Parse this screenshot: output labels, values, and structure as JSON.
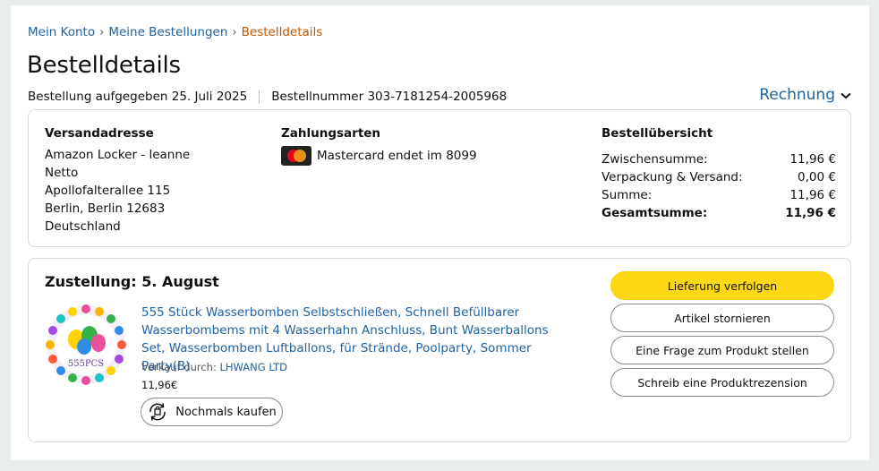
{
  "breadcrumb": {
    "items": [
      "Mein Konto",
      "Meine Bestellungen"
    ],
    "current": "Bestelldetails",
    "separator": "›"
  },
  "page_title": "Bestelldetails",
  "order_meta": {
    "placed": "Bestellung aufgegeben 25. Juli 2025",
    "number": "Bestellnummer 303-7181254-2005968"
  },
  "invoice_label": "Rechnung",
  "shipping": {
    "title": "Versandadresse",
    "lines": [
      "Amazon Locker - leanne",
      "Netto",
      "Apollofalterallee 115",
      "Berlin, Berlin 12683",
      "Deutschland"
    ]
  },
  "payment": {
    "title": "Zahlungsarten",
    "card_icon": "mastercard-icon",
    "card_text": "Mastercard endet im 8099"
  },
  "order_summary": {
    "title": "Bestellübersicht",
    "rows": [
      {
        "label": "Zwischensumme:",
        "value": "11,96 €"
      },
      {
        "label": "Verpackung & Versand:",
        "value": "0,00 €"
      },
      {
        "label": "Summe:",
        "value": "11,96 €"
      },
      {
        "label": "Gesamtsumme:",
        "value": "11,96 €"
      }
    ]
  },
  "delivery": {
    "title": "Zustellung: 5. August",
    "product": {
      "image_label": "555PCS",
      "title": "555 Stück Wasserbomben Selbstschließen, Schnell Befüllbarer Wasserbombems mit 4 Wasserhahn Anschluss, Bunt Wasserballons Set, Wasserbomben Luftballons, für Strände, Poolparty, Sommer Party(B)",
      "seller_prefix": "Verkauf durch:",
      "seller_name": "LHWANG LTD",
      "price": "11,96€"
    },
    "rebuy_label": "Nochmals kaufen",
    "rebuy_icon": "rebuy-cycle-icon"
  },
  "actions": {
    "track": "Lieferung verfolgen",
    "cancel": "Artikel stornieren",
    "question": "Eine Frage zum Produkt stellen",
    "review": "Schreib eine Produktrezension"
  },
  "colors": {
    "link": "#2162a1",
    "breadcrumb_current": "#c45500",
    "primary_button": "#ffd814",
    "page_background": "#eaeded"
  }
}
